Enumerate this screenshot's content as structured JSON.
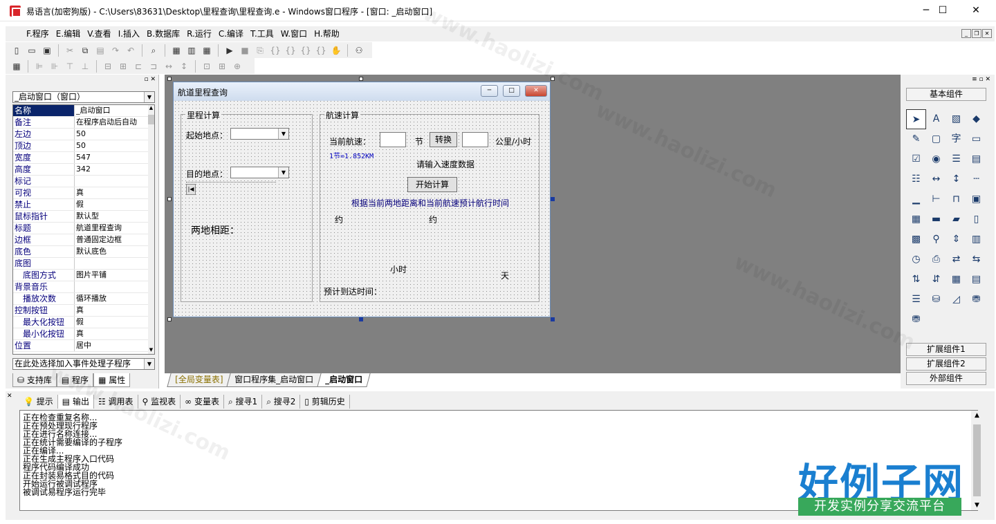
{
  "window": {
    "title": "易语言(加密狗版) - C:\\Users\\83631\\Desktop\\里程查询\\里程查询.e - Windows窗口程序 - [窗口: _启动窗口]",
    "minimize": "─",
    "maximize": "☐",
    "close": "✕"
  },
  "menu": [
    "F.程序",
    "E.编辑",
    "V.查看",
    "I.插入",
    "B.数据库",
    "R.运行",
    "C.编译",
    "T.工具",
    "W.窗口",
    "H.帮助"
  ],
  "left_panel": {
    "object_select": "_启动窗口（窗口）",
    "properties": [
      {
        "name": "名称",
        "value": "_启动窗口",
        "selected": true
      },
      {
        "name": "备注",
        "value": "在程序启动后自动"
      },
      {
        "name": "左边",
        "value": "50"
      },
      {
        "name": "顶边",
        "value": "50"
      },
      {
        "name": "宽度",
        "value": "547"
      },
      {
        "name": "高度",
        "value": "342"
      },
      {
        "name": "标记",
        "value": ""
      },
      {
        "name": "可视",
        "value": "真"
      },
      {
        "name": "禁止",
        "value": "假"
      },
      {
        "name": "鼠标指针",
        "value": "默认型"
      },
      {
        "name": "标题",
        "value": "航道里程查询"
      },
      {
        "name": "边框",
        "value": "普通固定边框"
      },
      {
        "name": "底色",
        "value": "默认底色"
      },
      {
        "name": "底图",
        "value": ""
      },
      {
        "name": "底图方式",
        "value": "图片平铺",
        "sub": true
      },
      {
        "name": "背景音乐",
        "value": ""
      },
      {
        "name": "播放次数",
        "value": "循环播放",
        "sub": true
      },
      {
        "name": "控制按钮",
        "value": "真"
      },
      {
        "name": "最大化按钮",
        "value": "假",
        "sub": true
      },
      {
        "name": "最小化按钮",
        "value": "真",
        "sub": true
      },
      {
        "name": "位置",
        "value": "居中"
      }
    ],
    "event_select": "在此处选择加入事件处理子程序",
    "tabs": [
      "支持库",
      "程序",
      "属性"
    ]
  },
  "form": {
    "title": "航道里程查询",
    "group_left": "里程计算",
    "group_right": "航速计算",
    "start_label": "起始地点：",
    "dest_label": "目的地点：",
    "distance_label": "两地相距：",
    "speed_label": "当前航速：",
    "knot_label": "节",
    "convert_btn": "转换",
    "kmh_label": "公里/小时",
    "knot_note": "1节=1.852KM",
    "input_hint": "请输入速度数据",
    "start_btn": "开始计算",
    "desc": "根据当前两地距离和当前航速预计航行时间",
    "about1": "约",
    "about2": "约",
    "hours": "小时",
    "days": "天",
    "eta": "预计到达时间："
  },
  "doc_tabs": [
    "[全局变量表]",
    "窗口程序集_启动窗口",
    "_启动窗口"
  ],
  "right_panel": {
    "basic": "基本组件",
    "ext1": "扩展组件1",
    "ext2": "扩展组件2",
    "external": "外部组件"
  },
  "bottom_tabs": [
    "提示",
    "输出",
    "调用表",
    "监视表",
    "变量表",
    "搜寻1",
    "搜寻2",
    "剪辑历史"
  ],
  "output_lines": [
    "正在检查重复名称...",
    "正在预处理现行程序",
    "正在进行名称连接...",
    "正在统计需要编译的子程序",
    "正在编译...",
    "正在生成主程序入口代码",
    "程序代码编译成功",
    "正在封装易格式目的代码",
    "开始运行被调试程序",
    "被调试易程序运行完毕"
  ],
  "logo": {
    "main": "好例子网",
    "sub": "开发实例分享交流平台"
  },
  "watermark": "www.haolizi.com"
}
